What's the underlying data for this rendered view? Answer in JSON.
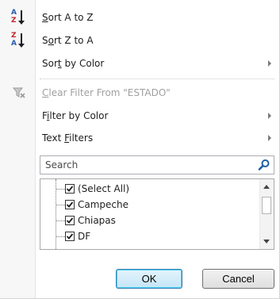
{
  "menu": {
    "sort_az": {
      "pre": "",
      "u": "S",
      "post": "ort A to Z",
      "icon_top": "A",
      "icon_bottom": "Z"
    },
    "sort_za": {
      "pre": "S",
      "u": "o",
      "post": "rt Z to A",
      "icon_top": "Z",
      "icon_bottom": "A"
    },
    "sort_color": {
      "pre": "Sor",
      "u": "t",
      "post": " by Color"
    },
    "clear_filter": {
      "pre": "",
      "u": "C",
      "post": "lear Filter From \"ESTADO\""
    },
    "filter_color": {
      "pre": "F",
      "u": "i",
      "post": "lter by Color"
    },
    "text_filters": {
      "pre": "Text ",
      "u": "F",
      "post": "ilters"
    }
  },
  "search": {
    "placeholder": "Search"
  },
  "list": {
    "items": [
      {
        "label": "(Select All)",
        "checked": true
      },
      {
        "label": "Campeche",
        "checked": true
      },
      {
        "label": "Chiapas",
        "checked": true
      },
      {
        "label": "DF",
        "checked": true
      }
    ]
  },
  "buttons": {
    "ok": "OK",
    "cancel": "Cancel"
  },
  "colors": {
    "gutter": "#f7f7f7",
    "ok_border": "#3c7fb1",
    "search_icon": "#1f5fa6"
  }
}
